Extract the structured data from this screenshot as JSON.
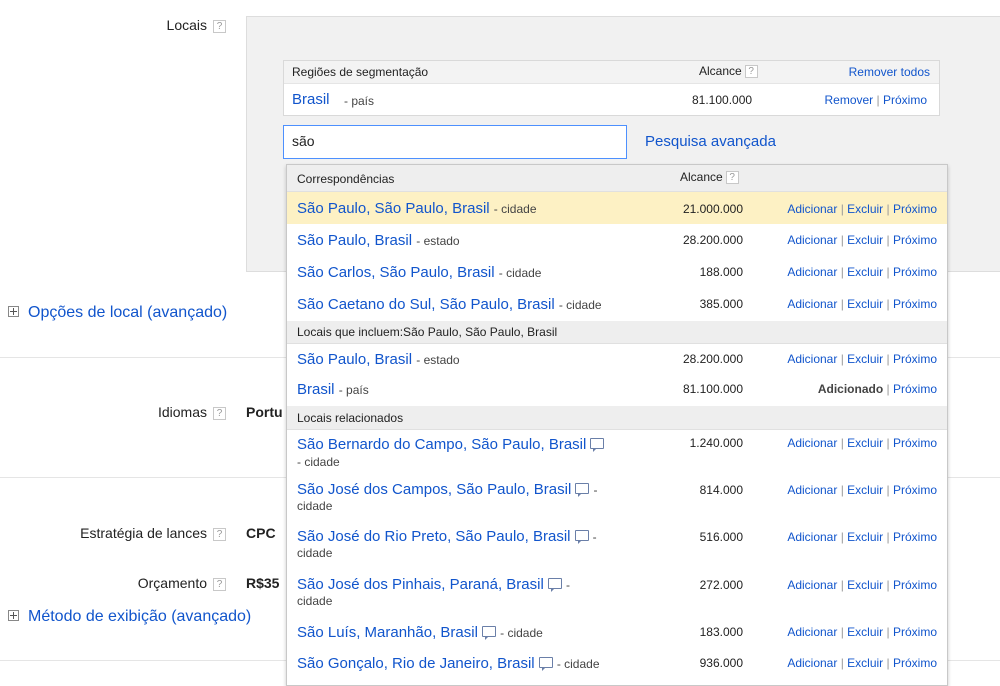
{
  "locations": {
    "label": "Locais",
    "help": "?",
    "targets_header": {
      "col_name": "Regiões de segmentação",
      "col_reach": "Alcance",
      "help": "?",
      "remove_all": "Remover todos"
    },
    "targets": [
      {
        "name": "Brasil",
        "type": "- país",
        "reach": "81.100.000",
        "remove": "Remover",
        "sep": "|",
        "nearby": "Próximo"
      }
    ],
    "search": {
      "value": "são",
      "advanced_link": "Pesquisa avançada"
    },
    "dropdown": {
      "header_matches": "Correspondências",
      "header_reach": "Alcance",
      "help": "?",
      "section_including": "Locais que incluem:São Paulo, São Paulo, Brasil",
      "section_related": "Locais relacionados",
      "add": "Adicionar",
      "exclude": "Excluir",
      "nearby": "Próximo",
      "added": "Adicionado",
      "sep": "|",
      "matches": [
        {
          "name": "São Paulo, São Paulo, Brasil",
          "type": "- cidade",
          "reach": "21.000.000"
        },
        {
          "name": "São Paulo, Brasil",
          "type": "- estado",
          "reach": "28.200.000"
        },
        {
          "name": "São Carlos, São Paulo, Brasil",
          "type": "- cidade",
          "reach": "188.000"
        },
        {
          "name": "São Caetano do Sul, São Paulo, Brasil",
          "type": "- cidade",
          "reach": "385.000"
        }
      ],
      "including": [
        {
          "name": "São Paulo, Brasil",
          "type": "- estado",
          "reach": "28.200.000"
        },
        {
          "name": "Brasil",
          "type": "- país",
          "reach": "81.100.000"
        }
      ],
      "related": [
        {
          "name": "São Bernardo do Campo, São Paulo, Brasil",
          "type": "- cidade",
          "reach": "1.240.000"
        },
        {
          "name": "São José dos Campos, São Paulo, Brasil",
          "type_a": "-",
          "type_b": "cidade",
          "reach": "814.000"
        },
        {
          "name": "São José do Rio Preto, São Paulo, Brasil",
          "type_a": "-",
          "type_b": "cidade",
          "reach": "516.000"
        },
        {
          "name": "São José dos Pinhais, Paraná, Brasil",
          "type_a": "-",
          "type_b": "cidade",
          "reach": "272.000"
        },
        {
          "name": "São Luís, Maranhão, Brasil",
          "type": "- cidade",
          "reach": "183.000"
        },
        {
          "name": "São Gonçalo, Rio de Janeiro, Brasil",
          "type": "- cidade",
          "reach": "936.000"
        }
      ]
    }
  },
  "location_options": {
    "label": "Opções de local (avançado)"
  },
  "languages": {
    "label": "Idiomas",
    "help": "?",
    "value": "Portu"
  },
  "bidding": {
    "label": "Estratégia de lances",
    "help": "?",
    "value": "CPC"
  },
  "budget": {
    "label": "Orçamento",
    "help": "?",
    "value": "R$35"
  },
  "delivery": {
    "label": "Método de exibição (avançado)"
  }
}
